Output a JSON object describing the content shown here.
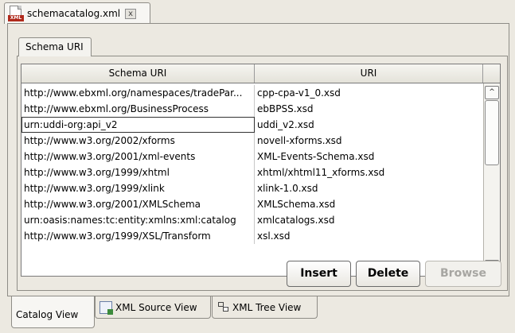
{
  "editor": {
    "file_name": "schemacatalog.xml",
    "close_symbol": "x"
  },
  "panel_tab": "Schema URI",
  "table": {
    "columns": [
      "Schema URI",
      "URI"
    ],
    "rows": [
      [
        "http://www.ebxml.org/namespaces/tradePar...",
        "cpp-cpa-v1_0.xsd"
      ],
      [
        "http://www.ebxml.org/BusinessProcess",
        "ebBPSS.xsd"
      ],
      [
        "urn:uddi-org:api_v2",
        "uddi_v2.xsd"
      ],
      [
        "http://www.w3.org/2002/xforms",
        "novell-xforms.xsd"
      ],
      [
        "http://www.w3.org/2001/xml-events",
        "XML-Events-Schema.xsd"
      ],
      [
        "http://www.w3.org/1999/xhtml",
        "xhtml/xhtml11_xforms.xsd"
      ],
      [
        "http://www.w3.org/1999/xlink",
        "xlink-1.0.xsd"
      ],
      [
        "http://www.w3.org/2001/XMLSchema",
        "XMLSchema.xsd"
      ],
      [
        "urn:oasis:names:tc:entity:xmlns:xml:catalog",
        "xmlcatalogs.xsd"
      ],
      [
        "http://www.w3.org/1999/XSL/Transform",
        "xsl.xsd"
      ]
    ],
    "focused_row": 2
  },
  "buttons": {
    "insert": "Insert",
    "delete": "Delete",
    "browse": "Browse"
  },
  "bottom_tabs": {
    "catalog_view": "Catalog View",
    "xml_source_view": "XML Source View",
    "xml_tree_view": "XML Tree View"
  },
  "scroll": {
    "up_symbol": "^",
    "down_symbol": "v"
  }
}
